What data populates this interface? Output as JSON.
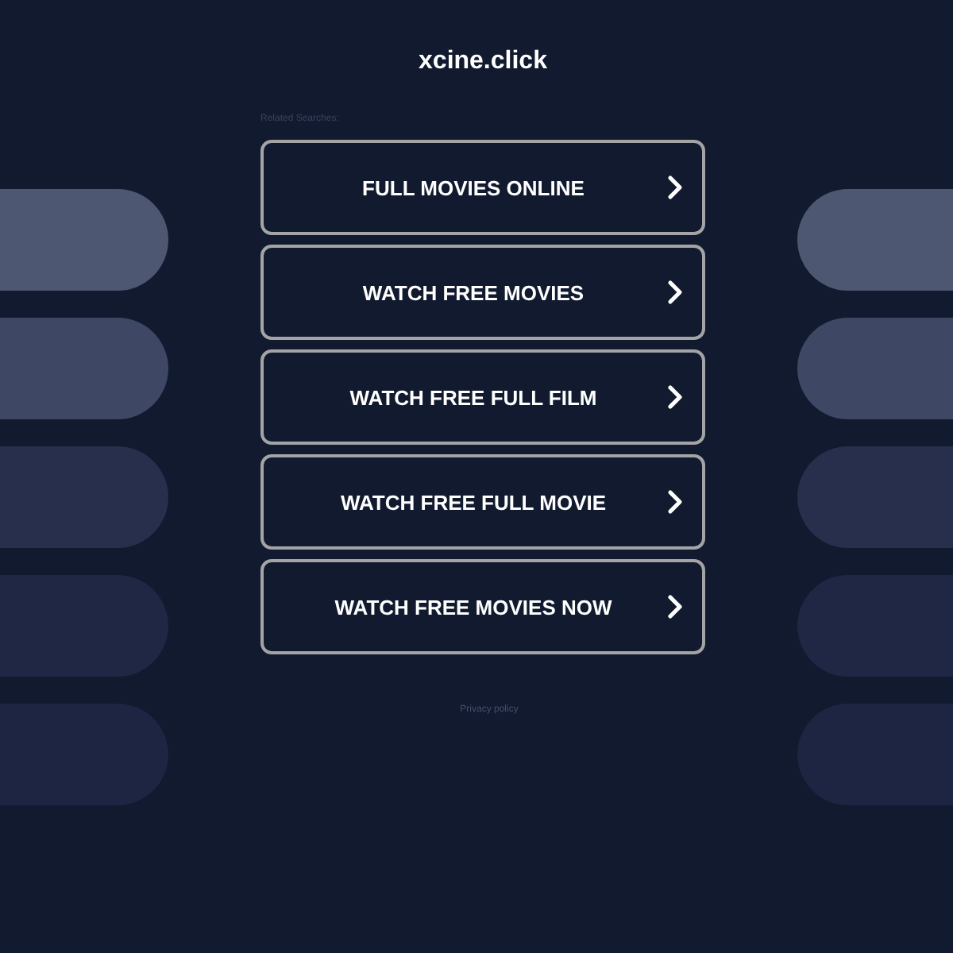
{
  "site_title": "xcine.click",
  "related_searches": {
    "label": "Related Searches:",
    "links": [
      {
        "label": "FULL MOVIES ONLINE"
      },
      {
        "label": "WATCH FREE MOVIES"
      },
      {
        "label": "WATCH FREE FULL FILM"
      },
      {
        "label": "WATCH FREE FULL MOVIE"
      },
      {
        "label": "WATCH FREE MOVIES NOW"
      }
    ]
  },
  "footer": {
    "privacy_link": "Privacy policy"
  }
}
